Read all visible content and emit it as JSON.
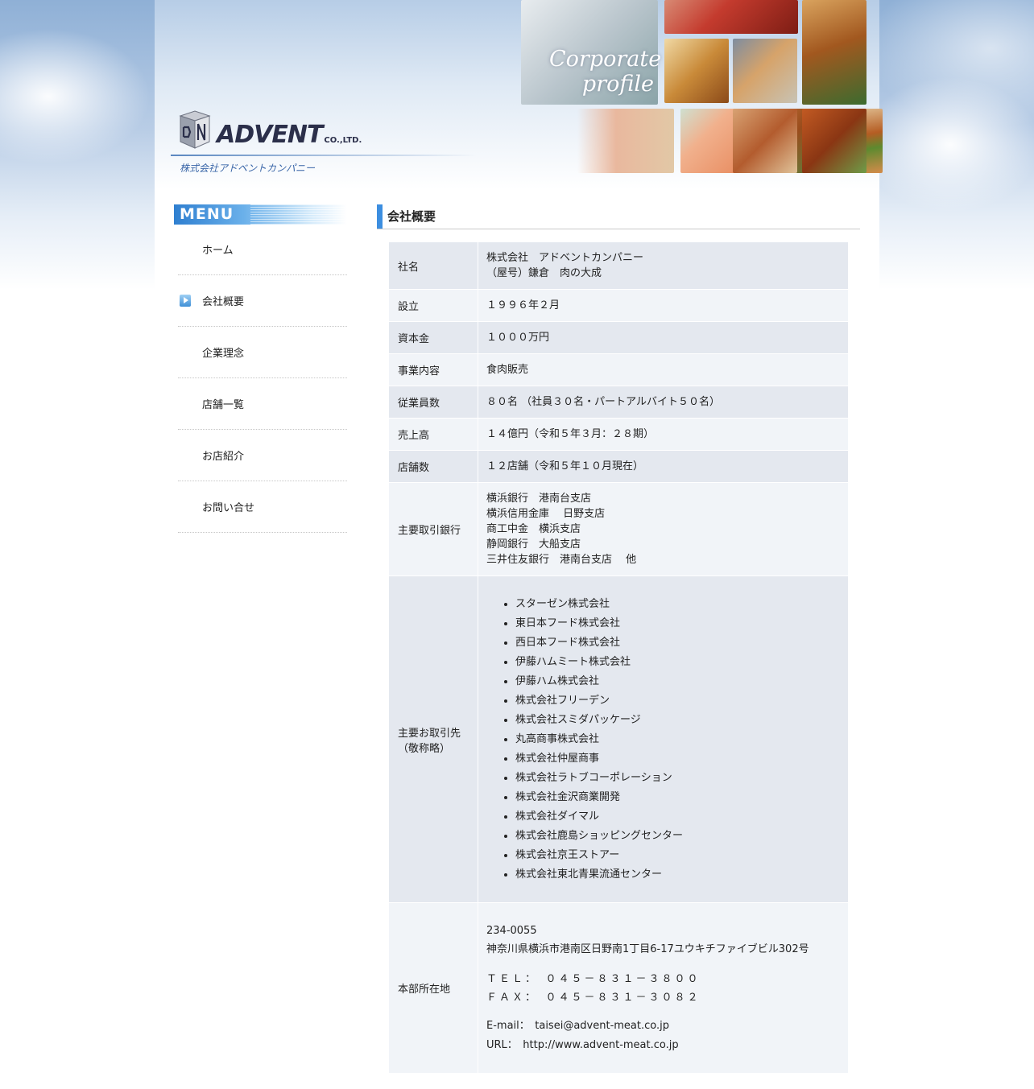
{
  "header": {
    "logo_text": "ADVENT",
    "logo_suffix": "CO.,LTD.",
    "company_jp": "株式会社アドベントカンパニー",
    "banner_title_line1": "Corporate",
    "banner_title_line2": "profile"
  },
  "sidebar": {
    "menu_title": "MENU",
    "items": [
      {
        "label": "ホーム",
        "active": false
      },
      {
        "label": "会社概要",
        "active": true
      },
      {
        "label": "企業理念",
        "active": false
      },
      {
        "label": "店舗一覧",
        "active": false
      },
      {
        "label": "お店紹介",
        "active": false
      },
      {
        "label": "お問い合せ",
        "active": false
      }
    ]
  },
  "main": {
    "section_title": "会社概要",
    "rows": {
      "name": {
        "key": "社名",
        "line1": "株式会社　アドベントカンパニー",
        "line2": "（屋号）鎌倉　肉の大成"
      },
      "founded": {
        "key": "設立",
        "value": "１９９６年２月"
      },
      "capital": {
        "key": "資本金",
        "value": "１０００万円"
      },
      "business": {
        "key": "事業内容",
        "value": "食肉販売"
      },
      "employees": {
        "key": "従業員数",
        "value": "８０名 （社員３０名・パートアルバイト５０名）"
      },
      "sales": {
        "key": "売上高",
        "value": "１４億円（令和５年３月：２８期）"
      },
      "stores": {
        "key": "店舗数",
        "value": "１２店舗（令和５年１０月現在）"
      },
      "banks": {
        "key": "主要取引銀行",
        "lines": [
          "横浜銀行　港南台支店",
          "横浜信用金庫　 日野支店",
          "商工中金　横浜支店",
          "静岡銀行　大船支店",
          "三井住友銀行　港南台支店　 他"
        ]
      },
      "clients": {
        "key_line1": "主要お取引先",
        "key_line2": "（敬称略）",
        "items": [
          "スターゼン株式会社",
          "東日本フード株式会社",
          "西日本フード株式会社",
          "伊藤ハムミート株式会社",
          "伊藤ハム株式会社",
          "株式会社フリーデン",
          "株式会社スミダパッケージ",
          "丸高商事株式会社",
          "株式会社仲屋商事",
          "株式会社ラトブコーポレーション",
          "株式会社金沢商業開発",
          "株式会社ダイマル",
          "株式会社鹿島ショッピングセンター",
          "株式会社京王ストアー",
          "株式会社東北青果流通センター"
        ]
      },
      "hq": {
        "key": "本部所在地",
        "postal": "234-0055",
        "address": "神奈川県横浜市港南区日野南1丁目6-17ユウキチファイブビル302号",
        "tel": "ＴＥＬ：　０４５－８３１－３８００",
        "fax": "ＦＡＸ：　０４５－８３１－３０８２",
        "email": "E-mail：　taisei@advent-meat.co.jp",
        "url": "URL：　http://www.advent-meat.co.jp"
      }
    }
  }
}
